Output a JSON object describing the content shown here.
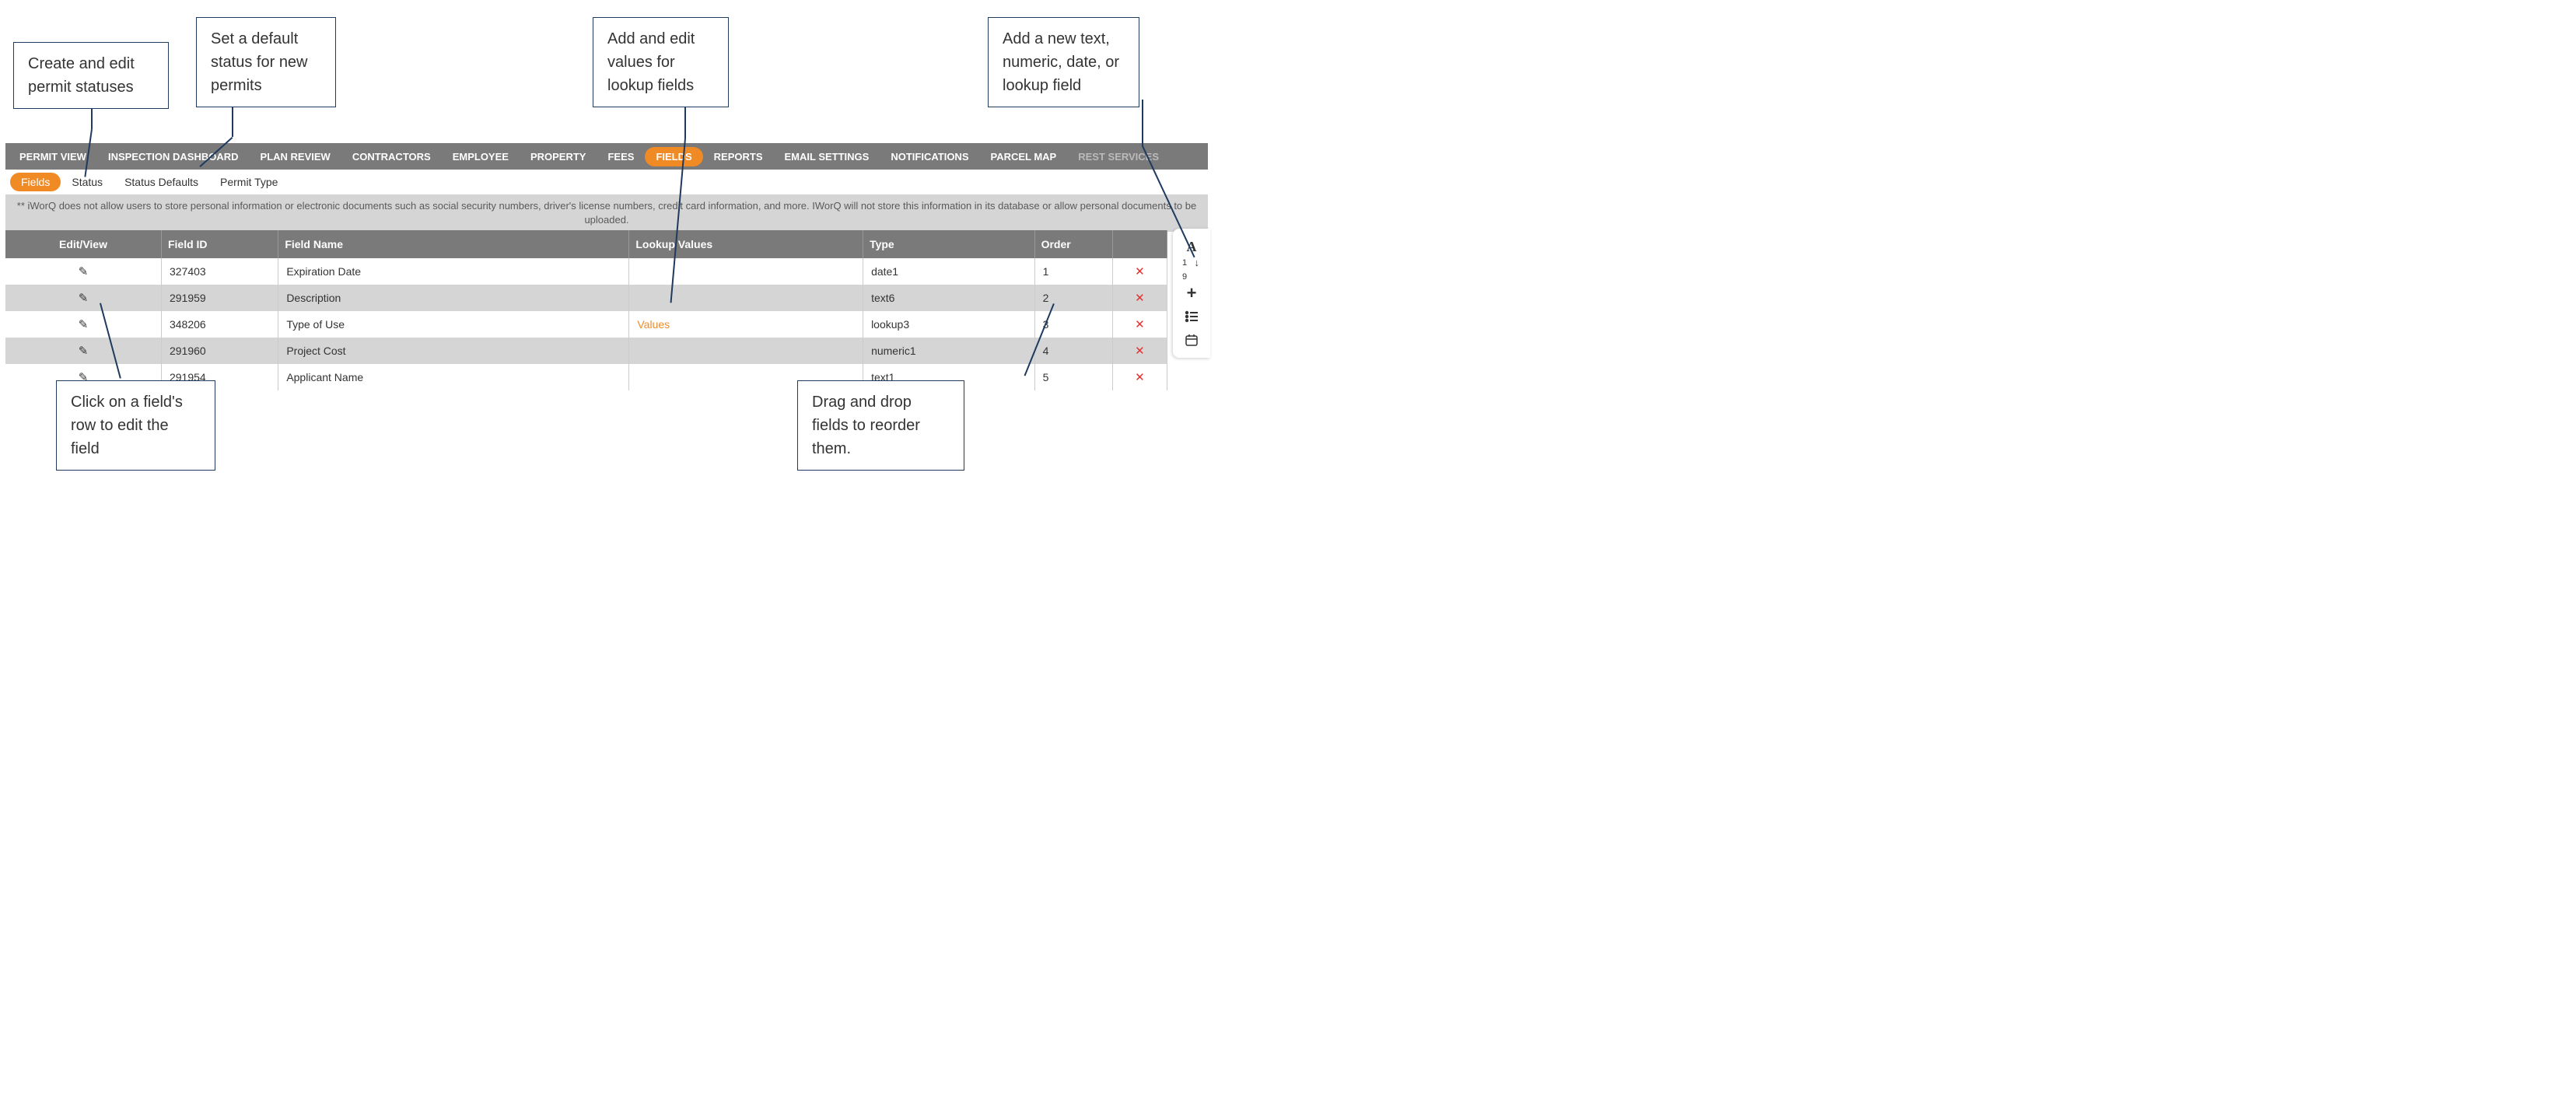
{
  "callouts": {
    "a": "Create and edit permit statuses",
    "b": "Set a default status for new permits",
    "c": "Add and edit values for lookup fields",
    "d": "Add a new text, numeric, date, or lookup field",
    "e": "Click on a field's row to edit the field",
    "f": "Drag and drop fields to reorder them."
  },
  "nav": {
    "items": [
      "PERMIT VIEW",
      "INSPECTION DASHBOARD",
      "PLAN REVIEW",
      "CONTRACTORS",
      "EMPLOYEE",
      "PROPERTY",
      "FEES",
      "FIELDS",
      "REPORTS",
      "EMAIL SETTINGS",
      "NOTIFICATIONS",
      "PARCEL MAP",
      "REST SERVICES"
    ]
  },
  "subnav": {
    "items": [
      "Fields",
      "Status",
      "Status Defaults",
      "Permit Type"
    ]
  },
  "disclaimer": "** iWorQ does not allow users to store personal information or electronic documents such as social security numbers, driver's license numbers, credit card information, and more. IWorQ will not store this information in its database or allow personal documents to be uploaded.",
  "table": {
    "headers": [
      "Edit/View",
      "Field ID",
      "Field Name",
      "Lookup Values",
      "Type",
      "Order",
      ""
    ],
    "rows": [
      {
        "id": "327403",
        "name": "Expiration Date",
        "lookup": "",
        "type": "date1",
        "order": "1"
      },
      {
        "id": "291959",
        "name": "Description",
        "lookup": "",
        "type": "text6",
        "order": "2"
      },
      {
        "id": "348206",
        "name": "Type of Use",
        "lookup": "Values",
        "type": "lookup3",
        "order": "3"
      },
      {
        "id": "291960",
        "name": "Project Cost",
        "lookup": "",
        "type": "numeric1",
        "order": "4"
      },
      {
        "id": "291954",
        "name": "Applicant Name",
        "lookup": "",
        "type": "text1",
        "order": "5"
      }
    ]
  },
  "sideTools": {
    "text": "A",
    "sort": "↓",
    "add": "+",
    "list": "≡",
    "date": "◻"
  }
}
